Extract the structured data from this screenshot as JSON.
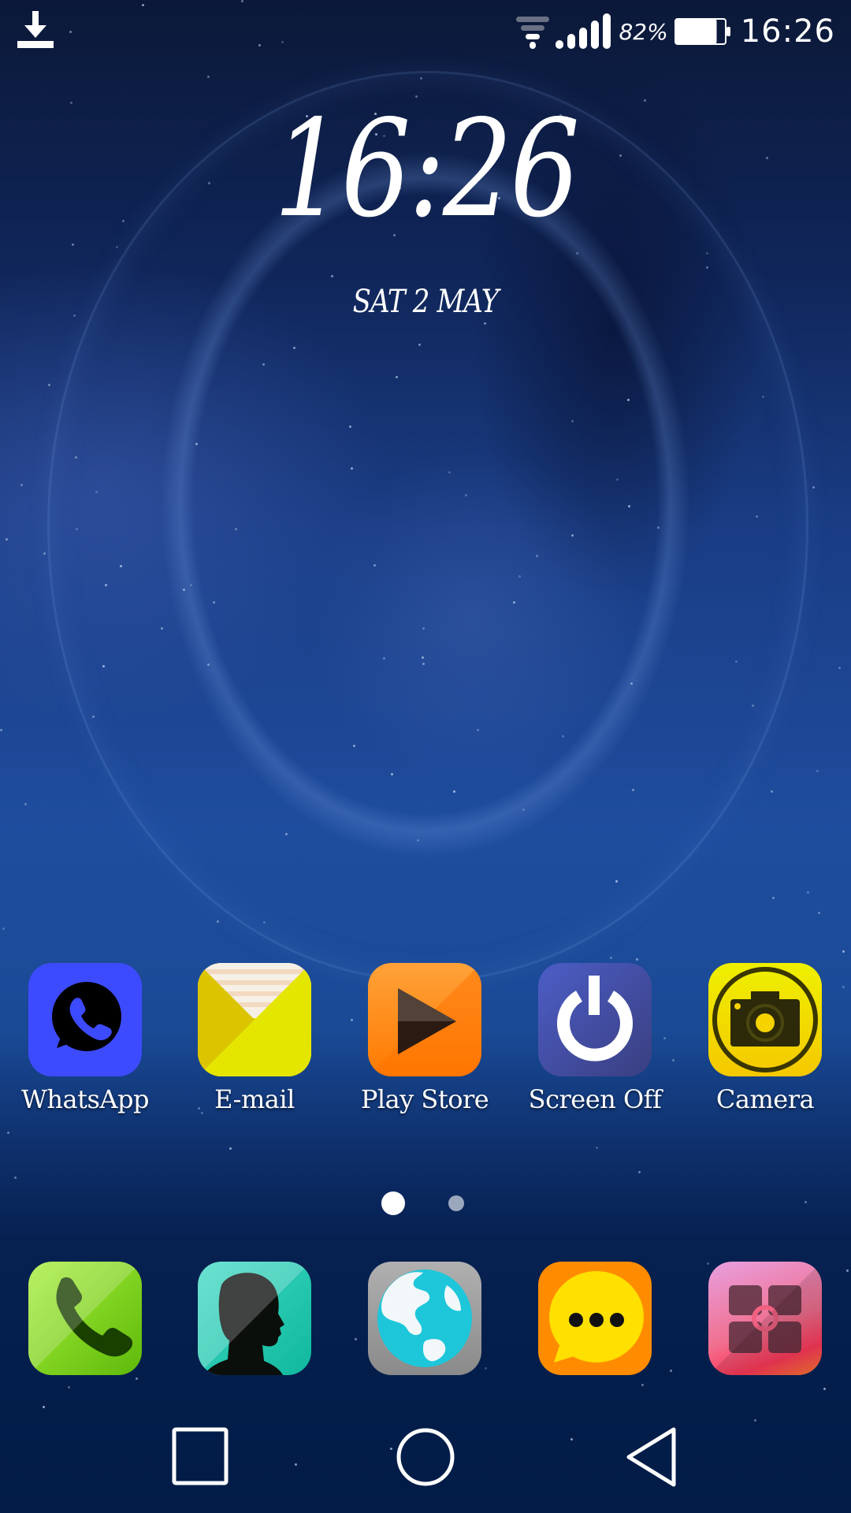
{
  "status_bar": {
    "notification_icons": [
      "download-icon"
    ],
    "wifi_icon": "wifi-icon",
    "signal_icon": "signal-icon",
    "battery_percent": "82%",
    "battery_level": 0.82,
    "time": "16:26"
  },
  "clock_widget": {
    "time": "16:26",
    "date": "SAT 2 MAY"
  },
  "home_apps": [
    {
      "label": "WhatsApp",
      "icon": "whatsapp-icon",
      "color": "#3d4bff"
    },
    {
      "label": "E-mail",
      "icon": "email-icon",
      "color": "#e3e000"
    },
    {
      "label": "Play Store",
      "icon": "play-store-icon",
      "color": "#ff8a14"
    },
    {
      "label": "Screen Off",
      "icon": "power-icon",
      "color": "#3f4a9a"
    },
    {
      "label": "Camera",
      "icon": "camera-icon",
      "color": "#f5d800"
    }
  ],
  "page_indicator": {
    "pages": 2,
    "current": 1
  },
  "dock_apps": [
    {
      "icon": "phone-icon",
      "color": "#7ad31a"
    },
    {
      "icon": "contacts-icon",
      "color": "#25c9b0"
    },
    {
      "icon": "browser-icon",
      "color": "#9a9a9a"
    },
    {
      "icon": "messaging-icon",
      "color": "#ff8c00"
    },
    {
      "icon": "themes-icon",
      "color": "#e8608a"
    }
  ],
  "nav_bar": {
    "buttons": [
      "recents",
      "home",
      "back"
    ]
  }
}
